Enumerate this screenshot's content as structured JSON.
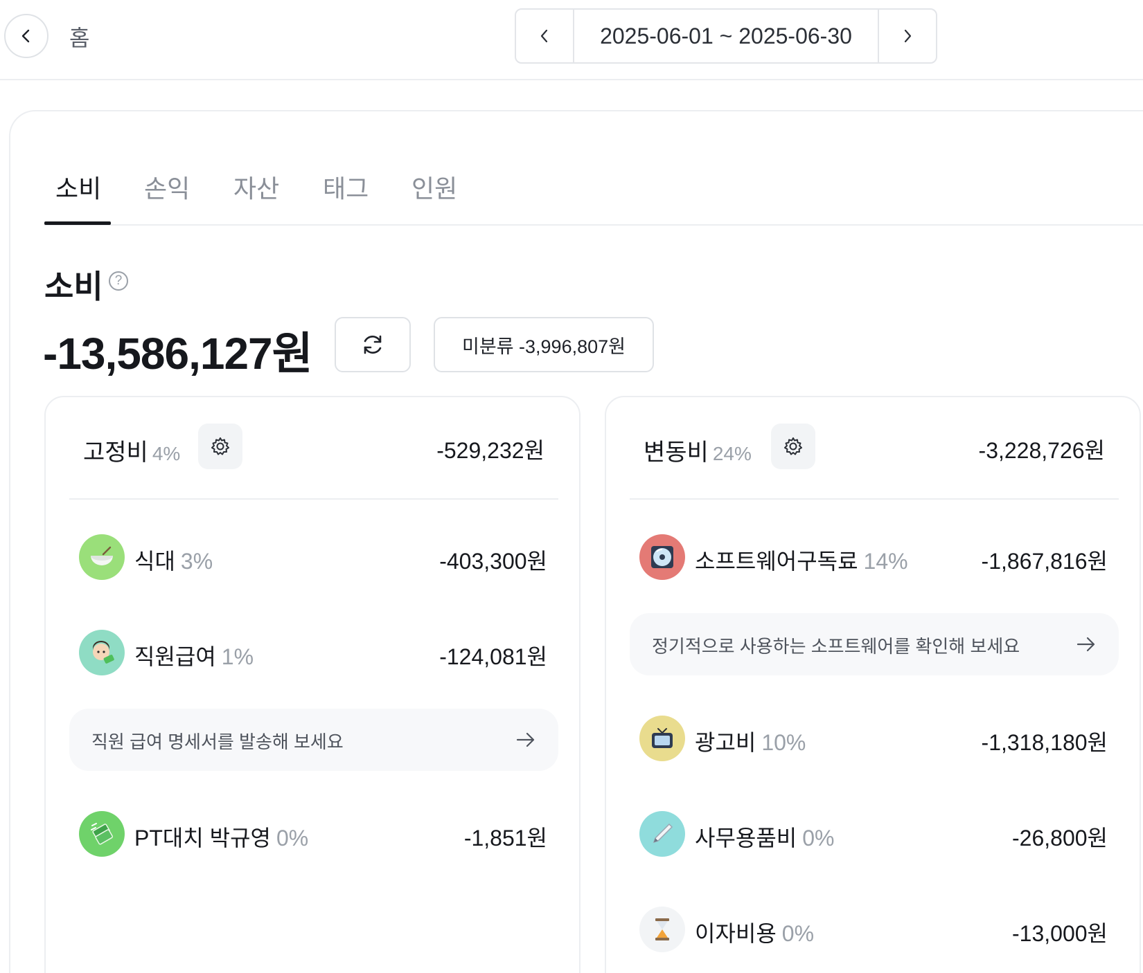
{
  "header": {
    "home_label": "홈",
    "date_range": "2025-06-01 ~ 2025-06-30"
  },
  "tabs": [
    {
      "label": "소비",
      "active": true
    },
    {
      "label": "손익",
      "active": false
    },
    {
      "label": "자산",
      "active": false
    },
    {
      "label": "태그",
      "active": false
    },
    {
      "label": "인원",
      "active": false
    }
  ],
  "summary": {
    "title": "소비",
    "help": "?",
    "total": "-13,586,127원",
    "unclassified": "미분류 -3,996,807원"
  },
  "fixed": {
    "name": "고정비",
    "pct": "4%",
    "total": "-529,232원",
    "items": [
      {
        "name": "식대",
        "pct": "3%",
        "amount": "-403,300원",
        "icon": "rice-bowl-icon"
      },
      {
        "name": "직원급여",
        "pct": "1%",
        "amount": "-124,081원",
        "icon": "employee-icon"
      },
      {
        "name": "PT대치 박규영",
        "pct": "0%",
        "amount": "-1,851원",
        "icon": "money-icon"
      }
    ],
    "promo": "직원 급여 명세서를 발송해 보세요"
  },
  "variable": {
    "name": "변동비",
    "pct": "24%",
    "total": "-3,228,726원",
    "items": [
      {
        "name": "소프트웨어구독료",
        "pct": "14%",
        "amount": "-1,867,816원",
        "icon": "disc-icon"
      },
      {
        "name": "광고비",
        "pct": "10%",
        "amount": "-1,318,180원",
        "icon": "tv-icon"
      },
      {
        "name": "사무용품비",
        "pct": "0%",
        "amount": "-26,800원",
        "icon": "pen-icon"
      },
      {
        "name": "이자비용",
        "pct": "0%",
        "amount": "-13,000원",
        "icon": "hourglass-icon"
      }
    ],
    "promo": "정기적으로 사용하는 소프트웨어를 확인해 보세요"
  },
  "colors": {
    "rice": "#9adf7a",
    "employee": "#8fdcc4",
    "money": "#6fd26a",
    "disc": "#e47a75",
    "tv": "#e9dc8e",
    "pen": "#8fdcdc",
    "hourglass": "#f2f4f6"
  }
}
